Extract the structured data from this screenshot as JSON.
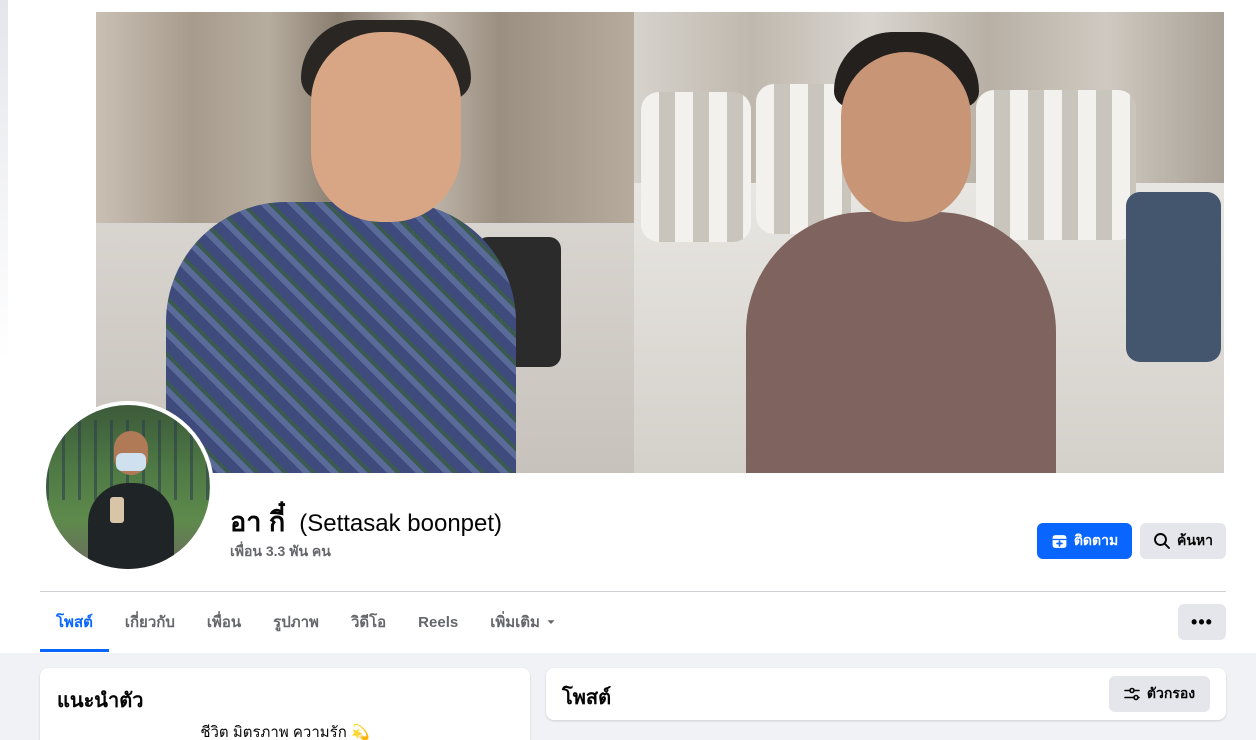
{
  "profile": {
    "name": "อา กี๋",
    "alt_name": "(Settasak boonpet)",
    "friends_count": "เพื่อน 3.3 พัน คน"
  },
  "actions": {
    "follow_label": "ติดตาม",
    "search_label": "ค้นหา",
    "more_label": "•••"
  },
  "tabs": [
    {
      "label": "โพสต์",
      "active": true
    },
    {
      "label": "เกี่ยวกับ"
    },
    {
      "label": "เพื่อน"
    },
    {
      "label": "รูปภาพ"
    },
    {
      "label": "วิดีโอ"
    },
    {
      "label": "Reels"
    },
    {
      "label": "เพิ่มเติม"
    }
  ],
  "intro": {
    "title": "แนะนำตัว",
    "bio": "ชีวิต มิตรภาพ ความรัก 💫"
  },
  "posts": {
    "title": "โพสต์",
    "filter_label": "ตัวกรอง"
  },
  "colors": {
    "accent": "#0866ff",
    "secondary_button": "#e4e6eb",
    "page_bg": "#f0f2f5",
    "muted_text": "#65676b"
  },
  "icons": {
    "follow": "add-person-icon",
    "search": "search-icon",
    "dropdown": "caret-down-icon",
    "filter": "sliders-icon"
  }
}
